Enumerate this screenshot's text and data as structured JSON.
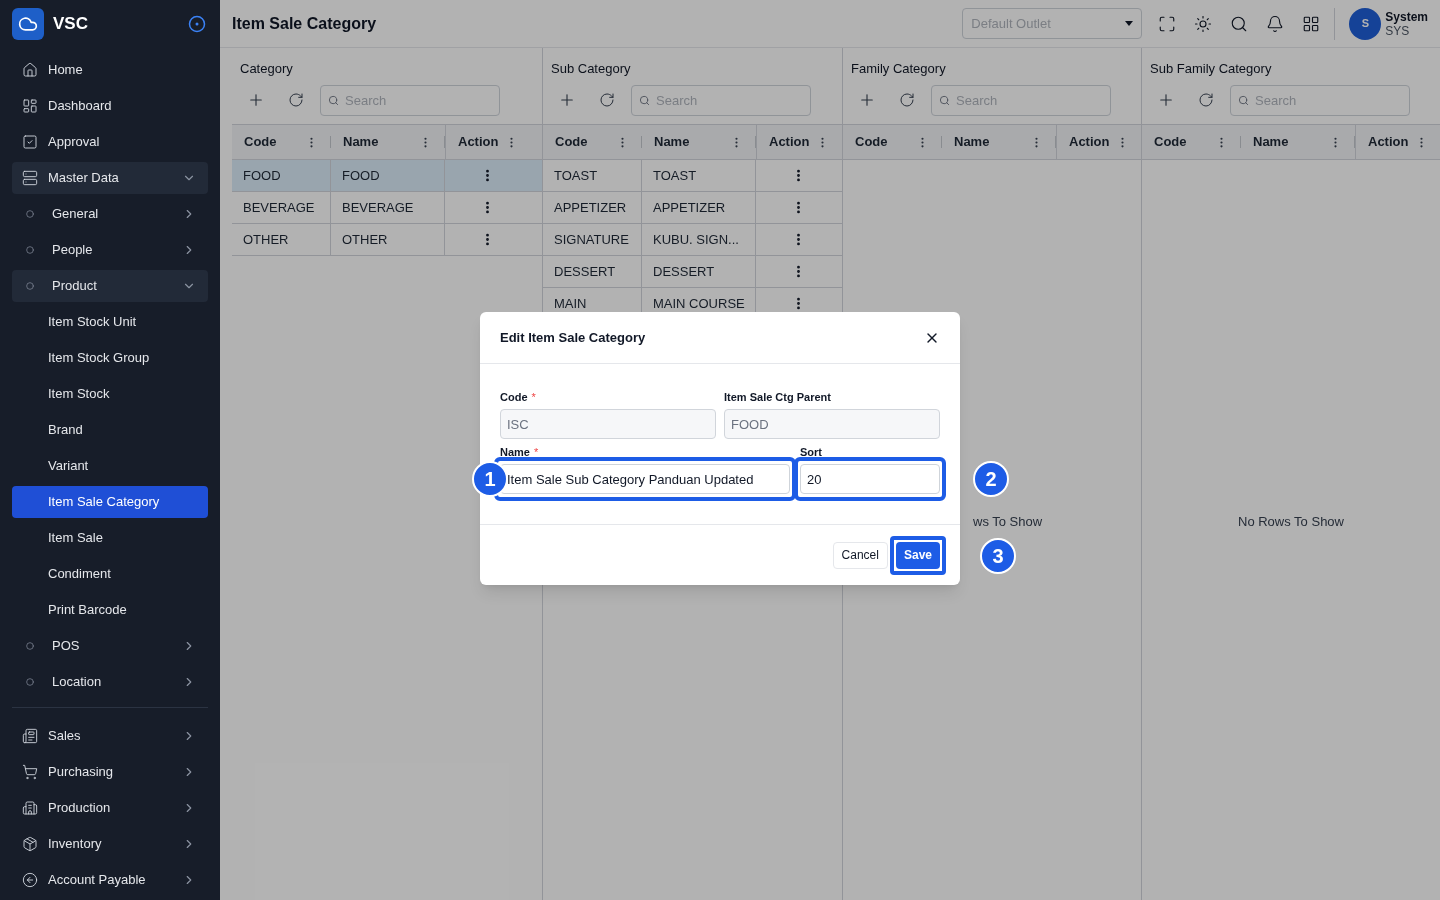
{
  "sidebar": {
    "brand": "VSC",
    "groups": [
      [
        {
          "label": "Home",
          "selected": false
        },
        {
          "label": "Dashboard",
          "selected": false
        },
        {
          "label": "Approval",
          "selected": false
        },
        {
          "label": "Master Data",
          "selected": false,
          "expanded": true,
          "children": [
            {
              "label": "General",
              "selected": false,
              "expanded": false
            },
            {
              "label": "People",
              "selected": false,
              "expanded": false
            },
            {
              "label": "Product",
              "selected": false,
              "expanded": true,
              "children": [
                {
                  "label": "Item Stock Unit",
                  "selected": false
                },
                {
                  "label": "Item Stock Group",
                  "selected": false
                },
                {
                  "label": "Item Stock",
                  "selected": false
                },
                {
                  "label": "Brand",
                  "selected": false
                },
                {
                  "label": "Variant",
                  "selected": false
                },
                {
                  "label": "Item Sale Category",
                  "selected": true
                },
                {
                  "label": "Item Sale",
                  "selected": false
                },
                {
                  "label": "Condiment",
                  "selected": false
                },
                {
                  "label": "Print Barcode",
                  "selected": false
                }
              ]
            },
            {
              "label": "POS",
              "selected": false,
              "expanded": false
            },
            {
              "label": "Location",
              "selected": false,
              "expanded": false
            }
          ]
        }
      ],
      [
        {
          "label": "Sales",
          "selected": false,
          "expanded": false
        },
        {
          "label": "Purchasing",
          "selected": false,
          "expanded": false
        },
        {
          "label": "Production",
          "selected": false,
          "expanded": false
        },
        {
          "label": "Inventory",
          "selected": false,
          "expanded": false
        },
        {
          "label": "Account Payable",
          "selected": false,
          "expanded": false
        }
      ]
    ]
  },
  "header": {
    "title": "Item Sale Category",
    "outlet": {
      "placeholder": "Default Outlet"
    },
    "user": {
      "initial": "S",
      "name": "System",
      "code": "SYS"
    }
  },
  "panels": [
    {
      "title": "Category",
      "search": {
        "placeholder": "Search"
      },
      "columns": [
        "Code",
        "Name",
        "Action"
      ],
      "rows": [
        {
          "code": "FOOD",
          "name": "FOOD",
          "selected": true
        },
        {
          "code": "BEVERAGE",
          "name": "BEVERAGE",
          "selected": false
        },
        {
          "code": "OTHER",
          "name": "OTHER",
          "selected": false
        }
      ]
    },
    {
      "title": "Sub Category",
      "search": {
        "placeholder": "Search"
      },
      "columns": [
        "Code",
        "Name",
        "Action"
      ],
      "rows": [
        {
          "code": "TOAST",
          "name": "TOAST",
          "selected": false
        },
        {
          "code": "APPETIZER",
          "name": "APPETIZER",
          "selected": false
        },
        {
          "code": "SIGNATURE",
          "name": "KUBU. SIGN...",
          "selected": false
        },
        {
          "code": "DESSERT",
          "name": "DESSERT",
          "selected": false
        },
        {
          "code": "MAIN",
          "name": "MAIN COURSE",
          "selected": false
        }
      ]
    },
    {
      "title": "Family Category",
      "search": {
        "placeholder": "Search"
      },
      "columns": [
        "Code",
        "Name",
        "Action"
      ],
      "empty_message": "ws To Show"
    },
    {
      "title": "Sub Family Category",
      "search": {
        "placeholder": "Search"
      },
      "columns": [
        "Code",
        "Name",
        "Action"
      ],
      "empty_message": "No Rows To Show"
    }
  ],
  "dialog": {
    "title": "Edit Item Sale Category",
    "fields": [
      {
        "label": "Code",
        "required_mark": "*",
        "value": "ISC",
        "disabled": true
      },
      {
        "label": "Item Sale Ctg Parent",
        "value": "FOOD",
        "disabled": true
      },
      {
        "label": "Name",
        "required_mark": "*",
        "value": "Item Sale Sub Category Panduan Updated",
        "disabled": false,
        "marker": "1"
      },
      {
        "label": "Sort",
        "value": "20",
        "disabled": false,
        "marker": "2"
      }
    ],
    "buttons": [
      {
        "label": "Cancel",
        "kind": "secondary"
      },
      {
        "label": "Save",
        "kind": "primary",
        "marker": "3"
      }
    ]
  }
}
